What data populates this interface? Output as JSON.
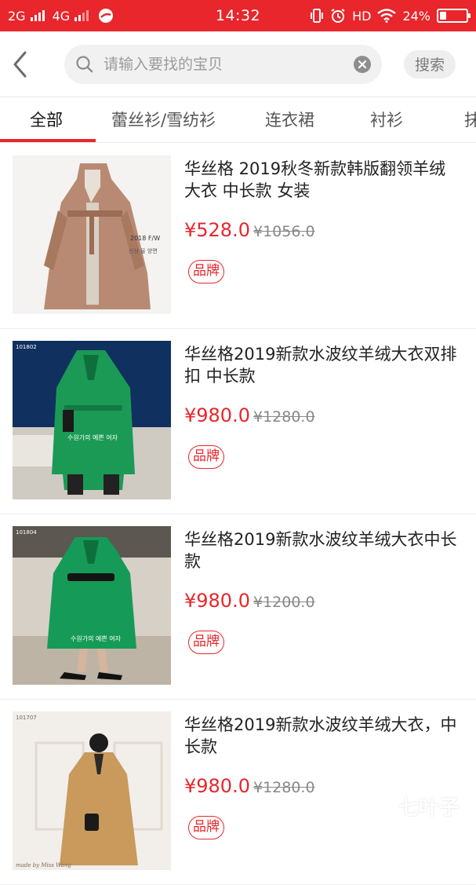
{
  "status_bar": {
    "signal_1": "2G",
    "signal_2": "4G",
    "time": "14:32",
    "hd": "HD",
    "battery_text": "24%",
    "battery_level": 0.24
  },
  "search": {
    "placeholder": "请输入要找的宝贝",
    "value": "",
    "button_label": "搜索"
  },
  "tabs": [
    {
      "label": "全部",
      "active": true
    },
    {
      "label": "蕾丝衫/雪纺衫",
      "active": false
    },
    {
      "label": "连衣裙",
      "active": false
    },
    {
      "label": "衬衫",
      "active": false
    },
    {
      "label": "抹",
      "active": false
    }
  ],
  "products": [
    {
      "title": "华丝格  2019秋冬新款韩版翻领羊绒大衣 中长款 女装",
      "price": "¥528.0",
      "original_price": "¥1056.0",
      "badge": "品牌",
      "image_caption_1": "2018 F/W",
      "image_caption_2": "신상 울 양면"
    },
    {
      "title": "华丝格2019新款水波纹羊绒大衣双排扣 中长款",
      "price": "¥980.0",
      "original_price": "¥1280.0",
      "badge": "品牌",
      "image_code": "101802",
      "image_caption": "수원가의 예쁜 여자"
    },
    {
      "title": "华丝格2019新款水波纹羊绒大衣中长款",
      "price": "¥980.0",
      "original_price": "¥1200.0",
      "badge": "品牌",
      "image_code": "101804",
      "image_caption": "수원가의 예쁜 여자"
    },
    {
      "title": "华丝格2019新款水波纹羊绒大衣，中长款",
      "price": "¥980.0",
      "original_price": "¥1280.0",
      "badge": "品牌",
      "image_code": "101707",
      "image_caption": "made by Miss Wang"
    }
  ],
  "watermark": {
    "brand": "七叶子",
    "domain": "7YZ.COM"
  },
  "colors": {
    "accent": "#e8262b",
    "text": "#222222",
    "muted": "#888888"
  }
}
